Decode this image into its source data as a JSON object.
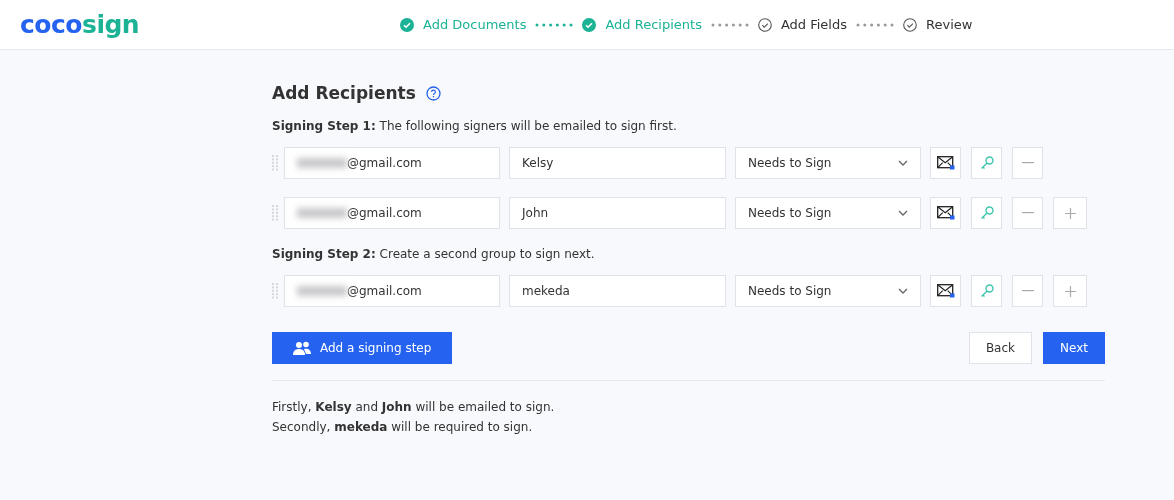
{
  "logo": {
    "part1": "coco",
    "part2": "sign"
  },
  "steps": [
    {
      "label": "Add Documents",
      "done": true
    },
    {
      "label": "Add Recipients",
      "done": true
    },
    {
      "label": "Add Fields",
      "done": false
    },
    {
      "label": "Review",
      "done": false
    }
  ],
  "title": "Add Recipients",
  "groups": [
    {
      "heading": "Signing Step 1:",
      "description": "The following signers will be emailed to sign first.",
      "recipients": [
        {
          "email": "@gmail.com",
          "name": "Kelsy",
          "role": "Needs to Sign",
          "can_add": false
        },
        {
          "email": "@gmail.com",
          "name": "John",
          "role": "Needs to Sign",
          "can_add": true
        }
      ]
    },
    {
      "heading": "Signing Step 2:",
      "description": "Create a second group to sign next.",
      "recipients": [
        {
          "email": "@gmail.com",
          "name": "mekeda",
          "role": "Needs to Sign",
          "can_add": true
        }
      ]
    }
  ],
  "add_step_button": "Add a signing step",
  "back_button": "Back",
  "next_button": "Next",
  "summary": [
    "Firstly, **Kelsy** and **John** will be emailed to sign.",
    "Secondly, **mekeda** will be required to sign."
  ]
}
